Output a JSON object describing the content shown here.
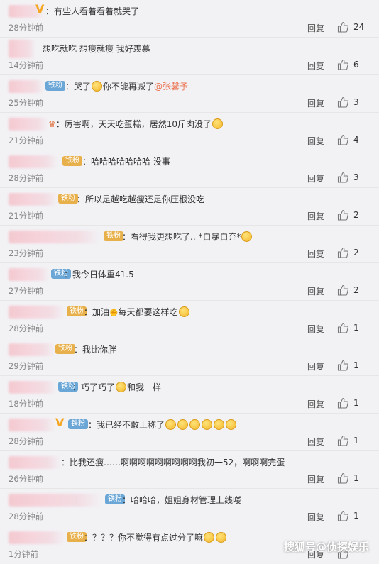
{
  "comments": [
    {
      "text": "有些人看着看着就哭了",
      "time": "28分钟前",
      "reply": "回复",
      "likes": "24"
    },
    {
      "text": "想吃就吃 想瘦就瘦 我好羡慕",
      "time": "14分钟前",
      "reply": "回复",
      "likes": "6"
    },
    {
      "text": "哭了",
      "text2": "你不能再减了",
      "mention": "@张馨予",
      "badge": "铁粉",
      "time": "25分钟前",
      "reply": "回复",
      "likes": "3"
    },
    {
      "text": "厉害啊，天天吃蛋糕，居然10斤肉没了",
      "time": "21分钟前",
      "reply": "回复",
      "likes": "4"
    },
    {
      "text": "哈哈哈哈哈哈哈 没事",
      "badge": "铁粉",
      "time": "28分钟前",
      "reply": "回复",
      "likes": "3"
    },
    {
      "text": "所以是越吃越瘦还是你压根没吃",
      "badge": "铁粉",
      "time": "21分钟前",
      "reply": "回复",
      "likes": "2"
    },
    {
      "text": "看得我更想吃了.. *自暴自弃*",
      "badge": "铁粉",
      "time": "23分钟前",
      "reply": "回复",
      "likes": "2"
    },
    {
      "text": "我今日体重41.5",
      "badge": "铁粉",
      "time": "27分钟前",
      "reply": "回复",
      "likes": "2"
    },
    {
      "text": "加油",
      "text2": "每天都要这样吃",
      "badge": "铁粉",
      "time": "28分钟前",
      "reply": "回复",
      "likes": "1"
    },
    {
      "text": "我比你胖",
      "badge": "铁粉",
      "time": "29分钟前",
      "reply": "回复",
      "likes": "1"
    },
    {
      "text": "巧了巧了",
      "text2": "和我一样",
      "badge": "铁粉",
      "time": "18分钟前",
      "reply": "回复",
      "likes": "1"
    },
    {
      "text": "我已经不敢上称了",
      "badge": "铁粉",
      "time": "28分钟前",
      "reply": "回复",
      "likes": "1"
    },
    {
      "text": "比我还瘦……啊啊啊啊啊啊啊啊啊我初一52，啊啊啊完蛋",
      "time": "26分钟前",
      "reply": "回复",
      "likes": "1"
    },
    {
      "text": "哈哈哈，姐姐身材管理上线喽",
      "badge": "铁粉",
      "time": "28分钟前",
      "reply": "回复",
      "likes": "1"
    },
    {
      "text": "？？？你不觉得有点过分了嘛",
      "badge": "铁粉",
      "time": "1分钟前",
      "reply": "回复",
      "likes": ""
    }
  ],
  "watermark": "搜狐号@侦探娱乐",
  "colors": {
    "mention": "#eb7350",
    "badge": "#6aa6d6",
    "badge_gold": "#e8b04a",
    "verify": "#f5a623"
  }
}
